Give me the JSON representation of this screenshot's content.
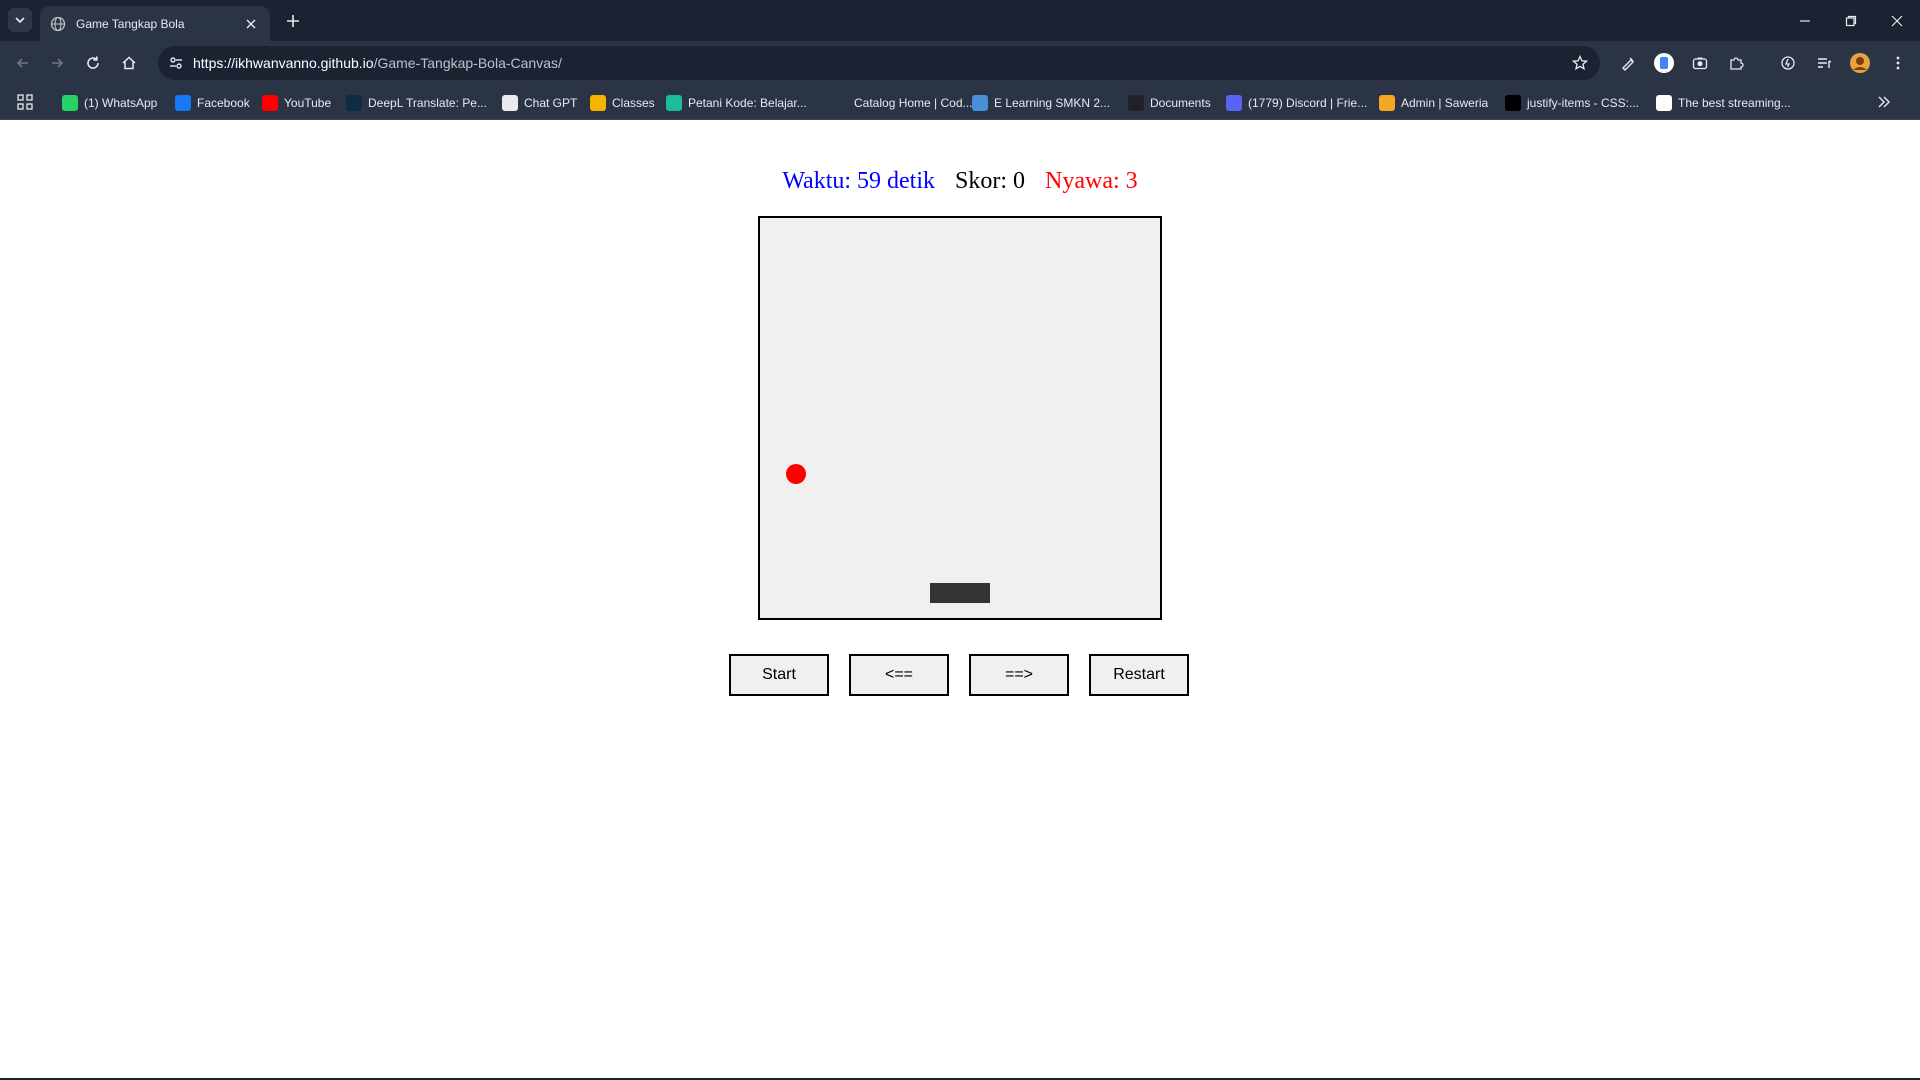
{
  "browser": {
    "tab_title": "Game Tangkap Bola",
    "url_host": "https://ikhwanvanno.github.io",
    "url_path": "/Game-Tangkap-Bola-Canvas/",
    "bookmarks": [
      {
        "label": "(1) WhatsApp",
        "icon": "whatsapp-icon",
        "color": "#25d366"
      },
      {
        "label": "Facebook",
        "icon": "facebook-icon",
        "color": "#1877f2"
      },
      {
        "label": "YouTube",
        "icon": "youtube-icon",
        "color": "#ff0000"
      },
      {
        "label": "DeepL Translate: Pe...",
        "icon": "deepl-icon",
        "color": "#0f2b46"
      },
      {
        "label": "Chat GPT",
        "icon": "chatgpt-icon",
        "color": "#e8eaed"
      },
      {
        "label": "Classes",
        "icon": "classroom-icon",
        "color": "#f4b400"
      },
      {
        "label": "Petani Kode: Belajar...",
        "icon": "petanikode-icon",
        "color": "#1abc9c"
      },
      {
        "label": "Catalog Home | Cod...",
        "icon": "codecademy-icon",
        "color": "#2b3445"
      },
      {
        "label": "E Learning SMKN 2...",
        "icon": "elearning-icon",
        "color": "#4a90d9"
      },
      {
        "label": "Documents",
        "icon": "documents-icon",
        "color": "#202124"
      },
      {
        "label": "(1779) Discord | Frie...",
        "icon": "discord-icon",
        "color": "#5865f2"
      },
      {
        "label": "Admin | Saweria",
        "icon": "saweria-icon",
        "color": "#f5a623"
      },
      {
        "label": "justify-items - CSS:...",
        "icon": "mdn-icon",
        "color": "#000000"
      },
      {
        "label": "The best streaming...",
        "icon": "streaming-icon",
        "color": "#ffffff"
      }
    ]
  },
  "game": {
    "time_label": "Waktu: 59 detik",
    "score_label": "Skor: 0",
    "lives_label": "Nyawa: 3",
    "buttons": {
      "start": "Start",
      "left": "<==",
      "right": "==>",
      "restart": "Restart"
    },
    "ball_color": "#ff0000",
    "paddle_color": "#333333",
    "canvas_bg": "#f0f0f0"
  }
}
